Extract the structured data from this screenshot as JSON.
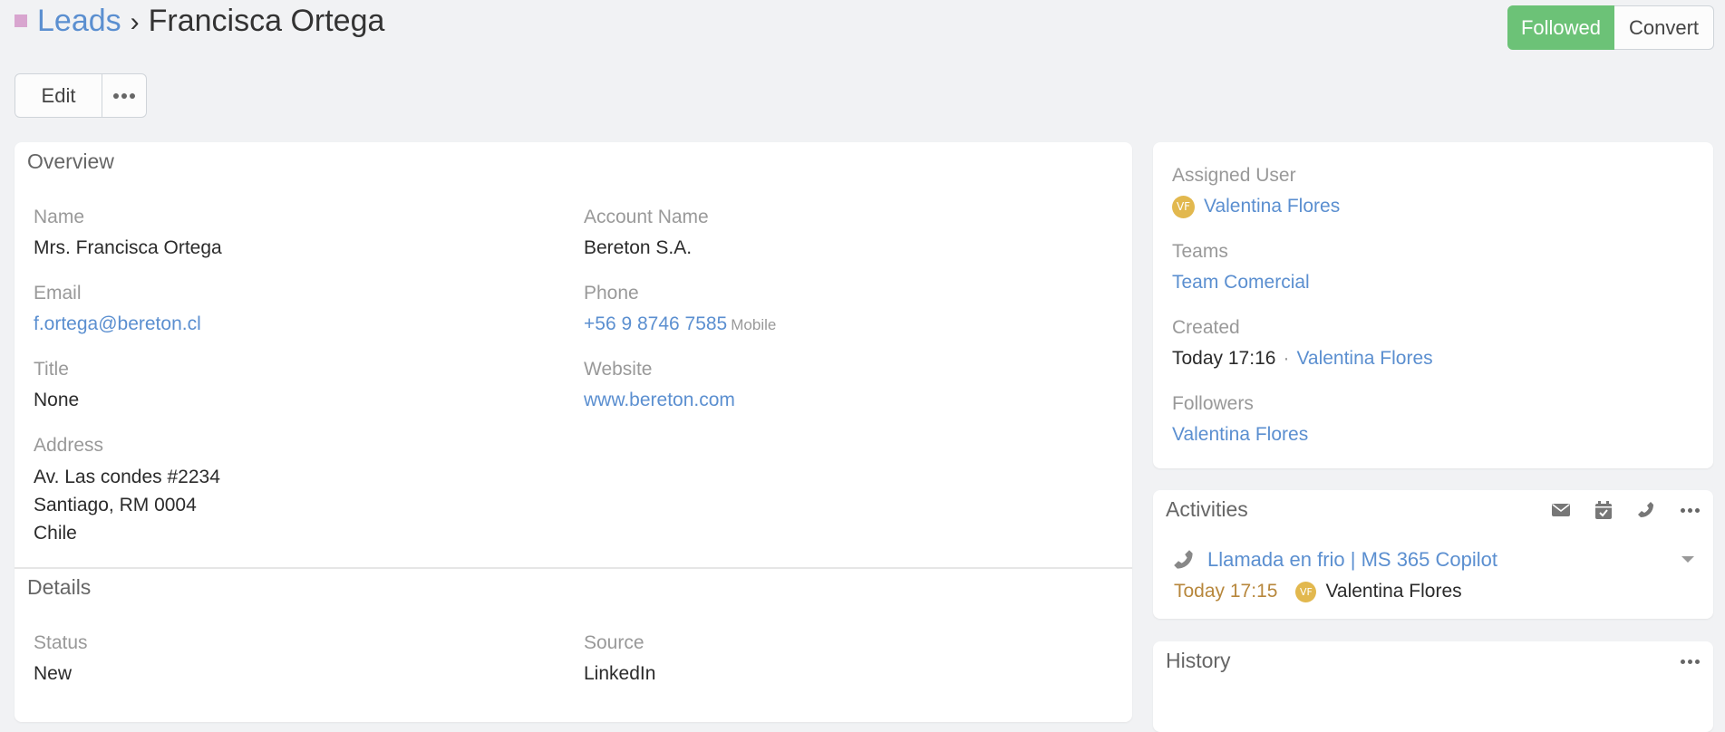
{
  "header": {
    "module_color": "#d8a5cf",
    "breadcrumb_module": "Leads",
    "breadcrumb_separator": "›",
    "record_name": "Francisca Ortega",
    "followed_label": "Followed",
    "convert_label": "Convert",
    "edit_label": "Edit",
    "more_icon": "ellipsis-icon"
  },
  "overview": {
    "title": "Overview",
    "fields": {
      "name": {
        "label": "Name",
        "value": "Mrs. Francisca Ortega"
      },
      "account_name": {
        "label": "Account Name",
        "value": "Bereton S.A."
      },
      "email": {
        "label": "Email",
        "value": "f.ortega@bereton.cl"
      },
      "phone": {
        "label": "Phone",
        "value": "+56 9 8746 7585",
        "type": "Mobile"
      },
      "title": {
        "label": "Title",
        "value": "None"
      },
      "website": {
        "label": "Website",
        "value": "www.bereton.com"
      },
      "address": {
        "label": "Address",
        "lines": [
          "Av. Las condes #2234",
          "Santiago, RM 0004",
          "Chile"
        ]
      }
    }
  },
  "details": {
    "title": "Details",
    "fields": {
      "status": {
        "label": "Status",
        "value": "New"
      },
      "source": {
        "label": "Source",
        "value": "LinkedIn"
      }
    }
  },
  "side": {
    "assigned_user": {
      "label": "Assigned User",
      "initials": "VF",
      "value": "Valentina Flores"
    },
    "teams": {
      "label": "Teams",
      "value": "Team Comercial"
    },
    "created": {
      "label": "Created",
      "date": "Today 17:16",
      "separator": "·",
      "user": "Valentina Flores"
    },
    "followers": {
      "label": "Followers",
      "value": "Valentina Flores"
    }
  },
  "activities": {
    "title": "Activities",
    "actions": [
      "envelope-icon",
      "calendar-check-icon",
      "phone-icon",
      "ellipsis-icon"
    ],
    "items": [
      {
        "icon": "phone-icon",
        "title": "Llamada en frio | MS 365 Copilot",
        "date": "Today 17:15",
        "initials": "VF",
        "user": "Valentina Flores"
      }
    ]
  },
  "history": {
    "title": "History"
  },
  "colors": {
    "accent": "#5b8fd0",
    "followed": "#6cc277",
    "avatar": "#e2b84e",
    "activity_date": "#b7873c"
  }
}
